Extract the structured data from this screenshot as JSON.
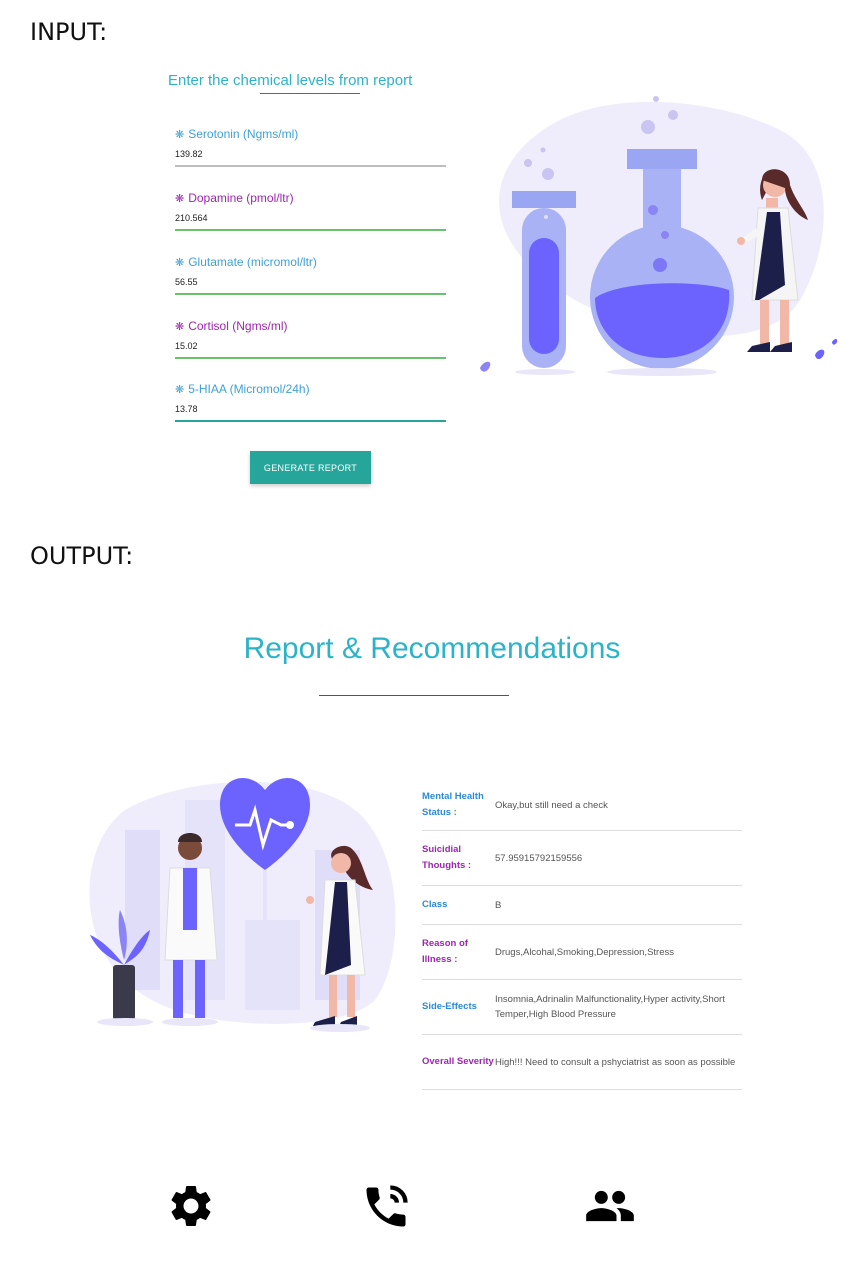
{
  "labels": {
    "input": "INPUT:",
    "output": "OUTPUT:"
  },
  "form": {
    "title": "Enter the chemical levels from report",
    "fields": [
      {
        "label": "Serotonin (Ngms/ml)",
        "value": "139.82",
        "color": "#3ea1d6"
      },
      {
        "label": "Dopamine (pmol/ltr)",
        "value": "210.564",
        "color": "#9c27b0"
      },
      {
        "label": "Glutamate (micromol/ltr)",
        "value": "56.55",
        "color": "#3ea1d6"
      },
      {
        "label": "Cortisol (Ngms/ml)",
        "value": "15.02",
        "color": "#9c27b0"
      },
      {
        "label": "5-HIAA (Micromol/24h)",
        "value": "13.78",
        "color": "#3ea1d6"
      }
    ],
    "button_label": "GENERATE REPORT",
    "icon": "bug-icon"
  },
  "report": {
    "title": "Report & Recommendations",
    "rows": [
      {
        "key": "Mental Health Status :",
        "value": "Okay,but still need a check",
        "key_color": "#2b8ad6"
      },
      {
        "key": "Suicidial Thoughts :",
        "value": "57.95915792159556",
        "key_color": "#9c27b0"
      },
      {
        "key": "Class",
        "value": "B",
        "key_color": "#2b8ad6"
      },
      {
        "key": "Reason of Illness :",
        "value": "Drugs,Alcohal,Smoking,Depression,Stress",
        "key_color": "#9c27b0"
      },
      {
        "key": "Side-Effects",
        "value": "Insomnia,Adrinalin Malfunctionality,Hyper activity,Short Temper,High Blood Pressure",
        "key_color": "#2b8ad6"
      },
      {
        "key": "Overall Severity",
        "value": "High!!! Need to consult a pshyciatrist as soon as possible",
        "key_color": "#9c27b0"
      }
    ]
  },
  "footer": {
    "icons": [
      "settings-gear-icon",
      "phone-call-icon",
      "people-group-icon"
    ]
  },
  "colors": {
    "accent": "#2bb3c8",
    "button": "#26a69a",
    "illustration": "#6c63ff"
  }
}
